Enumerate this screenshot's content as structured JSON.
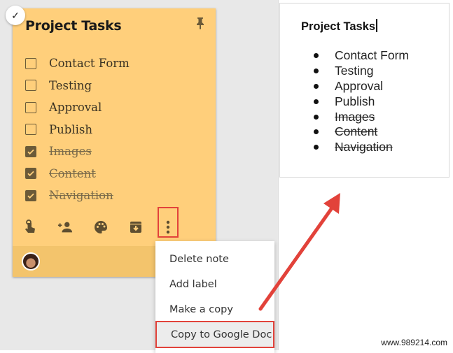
{
  "note": {
    "title": "Project Tasks",
    "pinned": true,
    "selected": true,
    "background_color": "#ffcf7b",
    "items": [
      {
        "label": "Contact Form",
        "checked": false
      },
      {
        "label": "Testing",
        "checked": false
      },
      {
        "label": "Approval",
        "checked": false
      },
      {
        "label": "Publish",
        "checked": false
      },
      {
        "label": "Images",
        "checked": true
      },
      {
        "label": "Content",
        "checked": true
      },
      {
        "label": "Navigation",
        "checked": true
      }
    ],
    "toolbar": {
      "icons": [
        "remind-me-icon",
        "collaborator-icon",
        "color-palette-icon",
        "archive-icon",
        "more-options-icon"
      ]
    }
  },
  "menu": {
    "items": [
      {
        "label": "Delete note"
      },
      {
        "label": "Add label"
      },
      {
        "label": "Make a copy"
      },
      {
        "label": "Copy to Google Doc",
        "highlighted": true
      }
    ]
  },
  "doc": {
    "title": "Project Tasks",
    "items": [
      {
        "text": "Contact Form",
        "struck": false
      },
      {
        "text": "Testing",
        "struck": false
      },
      {
        "text": "Approval",
        "struck": false
      },
      {
        "text": "Publish",
        "struck": false
      },
      {
        "text": "Images",
        "struck": true
      },
      {
        "text": "Content",
        "struck": true
      },
      {
        "text": "Navigation",
        "struck": true
      }
    ]
  },
  "annotation": {
    "highlight_color": "#e2423a"
  },
  "watermark": "www.989214.com"
}
